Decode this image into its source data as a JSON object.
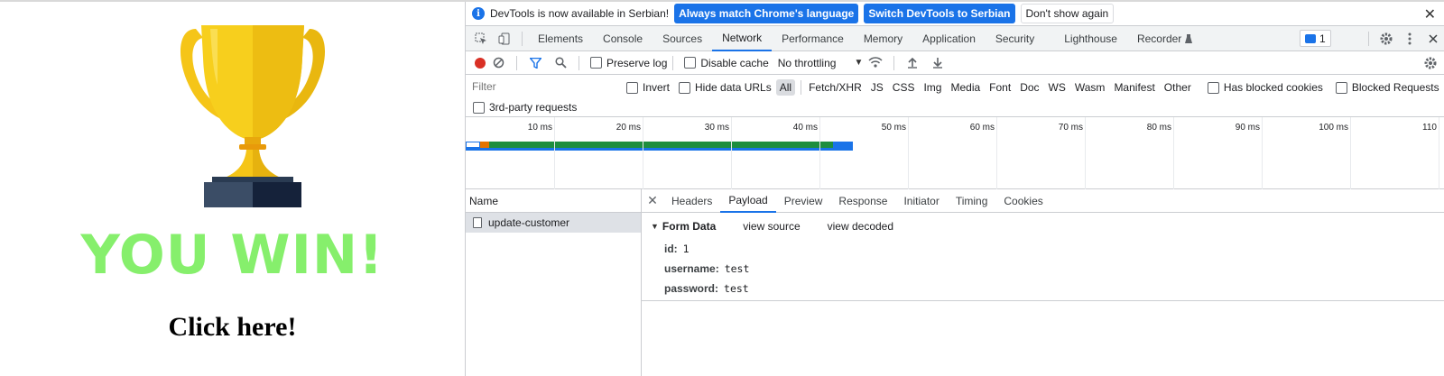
{
  "page": {
    "title": "YOU WIN!",
    "link": "Click here!",
    "colors": {
      "title": "#86ef6c",
      "trophy_gold": "#f5c518",
      "trophy_base": "#1f2a3c"
    }
  },
  "infobar": {
    "message": "DevTools is now available in Serbian!",
    "btn_match": "Always match Chrome's language",
    "btn_switch": "Switch DevTools to Serbian",
    "btn_dismiss": "Don't show again",
    "close": "✕"
  },
  "tabs": {
    "items": [
      "Elements",
      "Console",
      "Sources",
      "Network",
      "Performance",
      "Memory",
      "Application",
      "Security",
      "Lighthouse",
      "Recorder"
    ],
    "active": "Network",
    "issues_count": "1"
  },
  "toolbar": {
    "preserve_log": "Preserve log",
    "disable_cache": "Disable cache",
    "throttling": "No throttling"
  },
  "filter": {
    "placeholder": "Filter",
    "invert": "Invert",
    "hide_data_urls": "Hide data URLs",
    "types": [
      "All",
      "Fetch/XHR",
      "JS",
      "CSS",
      "Img",
      "Media",
      "Font",
      "Doc",
      "WS",
      "Wasm",
      "Manifest",
      "Other"
    ],
    "active_type": "All",
    "has_blocked_cookies": "Has blocked cookies",
    "blocked_requests": "Blocked Requests",
    "third_party": "3rd-party requests"
  },
  "overview": {
    "ticks": [
      "10 ms",
      "20 ms",
      "30 ms",
      "40 ms",
      "50 ms",
      "60 ms",
      "70 ms",
      "80 ms",
      "90 ms",
      "100 ms",
      "110"
    ]
  },
  "requests": {
    "header": "Name",
    "rows": [
      "update-customer"
    ]
  },
  "details": {
    "tabs": [
      "Headers",
      "Payload",
      "Preview",
      "Response",
      "Initiator",
      "Timing",
      "Cookies"
    ],
    "active": "Payload",
    "form_title": "Form Data",
    "view_source": "view source",
    "view_decoded": "view decoded",
    "fields": [
      {
        "key": "id:",
        "value": "1"
      },
      {
        "key": "username:",
        "value": "test"
      },
      {
        "key": "password:",
        "value": "test"
      }
    ]
  }
}
